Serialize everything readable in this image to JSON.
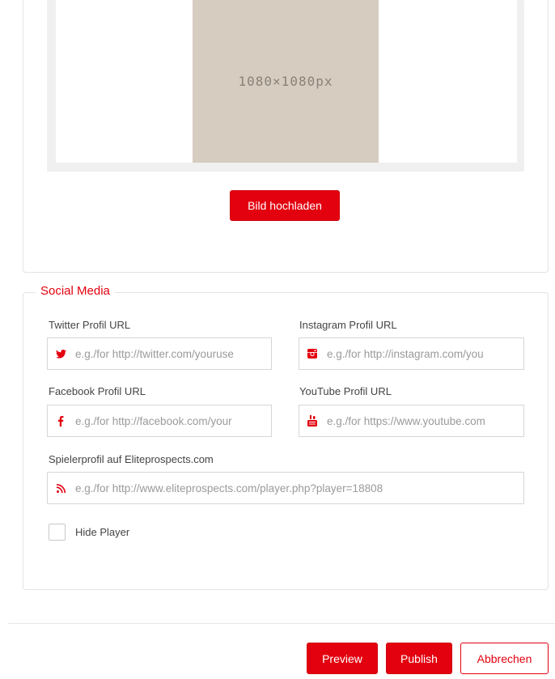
{
  "upload": {
    "image_placeholder": "1080×1080px",
    "upload_button": "Bild hochladen"
  },
  "social_media": {
    "legend": "Social Media",
    "twitter": {
      "label": "Twitter Profil URL",
      "placeholder": "e.g./for http://twitter.com/youruse"
    },
    "instagram": {
      "label": "Instagram Profil URL",
      "placeholder": "e.g./for http://instagram.com/you"
    },
    "facebook": {
      "label": "Facebook Profil URL",
      "placeholder": "e.g./for http://facebook.com/your"
    },
    "youtube": {
      "label": "YouTube Profil URL",
      "placeholder": "e.g./for https://www.youtube.com"
    },
    "eliteprospects": {
      "label": "Spielerprofil auf Eliteprospects.com",
      "placeholder": "e.g./for http://www.eliteprospects.com/player.php?player=18808"
    },
    "hide_player_label": "Hide Player"
  },
  "actions": {
    "preview": "Preview",
    "publish": "Publish",
    "cancel": "Abbrechen"
  },
  "icons": {
    "twitter": "twitter-icon",
    "instagram": "instagram-icon",
    "facebook": "facebook-icon",
    "youtube": "youtube-icon",
    "rss": "rss-icon"
  },
  "colors": {
    "accent": "#e3000f",
    "placeholder_image_bg": "#d6ccc0"
  }
}
